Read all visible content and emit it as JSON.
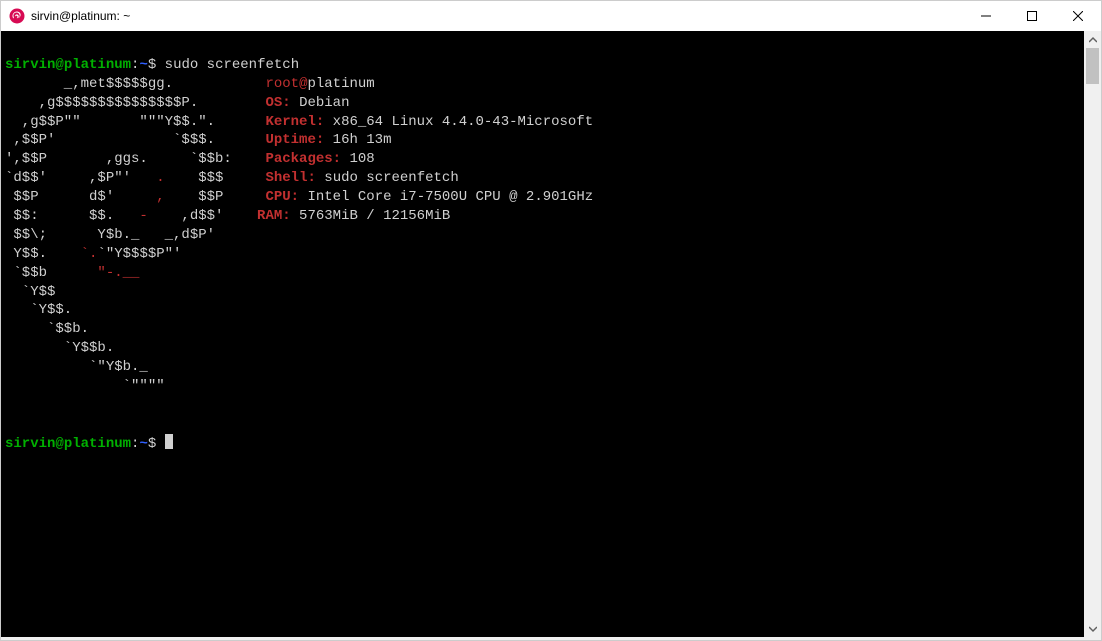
{
  "window": {
    "title": "sirvin@platinum: ~"
  },
  "prompt": {
    "user": "sirvin",
    "at": "@",
    "host": "platinum",
    "colon": ":",
    "cwd": "~",
    "dollar": "$ ",
    "command": "sudo screenfetch"
  },
  "art": {
    "l01a": "       _,met$$$$$gg.           ",
    "l02a": "    ,g$$$$$$$$$$$$$$$P.        ",
    "l03a": "  ,g$$P\"\"       \"\"\"Y$$.\".      ",
    "l04a": " ,$$P'              `$$$.      ",
    "l05a": "',$$P       ,ggs.     `$$b:    ",
    "l06a": "`d$$'     ,$P\"'   ",
    "l06r": ".",
    "l06b": "    $$$     ",
    "l07a": " $$P      d$'     ",
    "l07r": ",",
    "l07b": "    $$P     ",
    "l08a": " $$:      $$.   ",
    "l08r": "-",
    "l08b": "    ,d$$'    ",
    "l09a": " $$\\;      Y$b._   _,d$P'      ",
    "l10a": " Y$$.    ",
    "l10r": "`.",
    "l10b": "`\"Y$$$$P\"'          ",
    "l11a": " `$$b      ",
    "l11r": "\"-.__",
    "l11b": "               ",
    "l12a": "  `Y$$                         ",
    "l13a": "   `Y$$.                       ",
    "l14a": "     `$$b.                     ",
    "l15a": "       `Y$$b.                  ",
    "l16a": "          `\"Y$b._              ",
    "l17a": "              `\"\"\"\"            "
  },
  "info": {
    "userhost_user": "root",
    "userhost_at": "@",
    "userhost_host": "platinum",
    "os_label": "OS:",
    "os_value": " Debian",
    "kernel_label": "Kernel:",
    "kernel_value": " x86_64 Linux 4.4.0-43-Microsoft",
    "uptime_label": "Uptime:",
    "uptime_value": " 16h 13m",
    "packages_label": "Packages:",
    "packages_value": " 108",
    "shell_label": "Shell:",
    "shell_value": " sudo screenfetch",
    "cpu_label": "CPU:",
    "cpu_value": " Intel Core i7-7500U CPU @ 2.901GHz",
    "ram_label": "RAM:",
    "ram_value": " 5763MiB / 12156MiB"
  },
  "blank": "",
  "prompt2": {
    "user": "sirvin",
    "at": "@",
    "host": "platinum",
    "colon": ":",
    "cwd": "~",
    "dollar": "$ "
  }
}
